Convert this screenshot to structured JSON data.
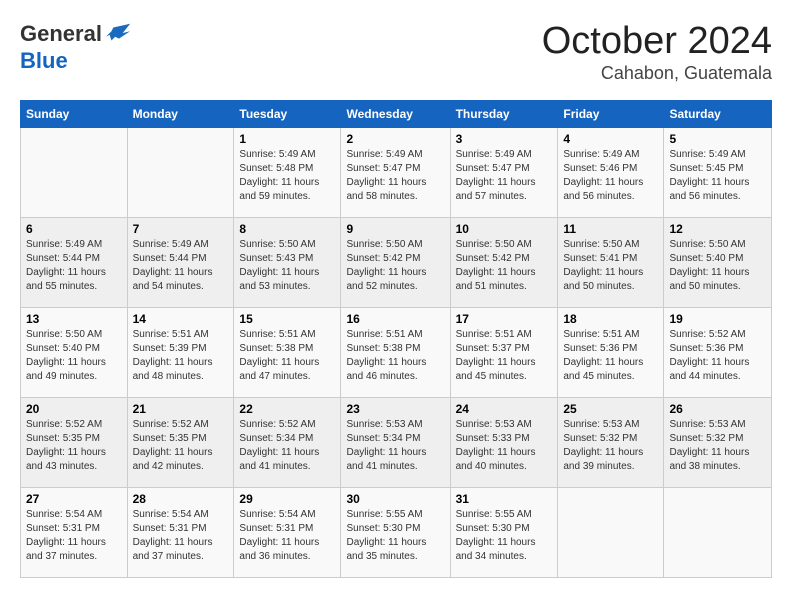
{
  "header": {
    "logo_general": "General",
    "logo_blue": "Blue",
    "month": "October 2024",
    "location": "Cahabon, Guatemala"
  },
  "weekdays": [
    "Sunday",
    "Monday",
    "Tuesday",
    "Wednesday",
    "Thursday",
    "Friday",
    "Saturday"
  ],
  "weeks": [
    [
      {
        "day": "",
        "info": ""
      },
      {
        "day": "",
        "info": ""
      },
      {
        "day": "1",
        "info": "Sunrise: 5:49 AM\nSunset: 5:48 PM\nDaylight: 11 hours and 59 minutes."
      },
      {
        "day": "2",
        "info": "Sunrise: 5:49 AM\nSunset: 5:47 PM\nDaylight: 11 hours and 58 minutes."
      },
      {
        "day": "3",
        "info": "Sunrise: 5:49 AM\nSunset: 5:47 PM\nDaylight: 11 hours and 57 minutes."
      },
      {
        "day": "4",
        "info": "Sunrise: 5:49 AM\nSunset: 5:46 PM\nDaylight: 11 hours and 56 minutes."
      },
      {
        "day": "5",
        "info": "Sunrise: 5:49 AM\nSunset: 5:45 PM\nDaylight: 11 hours and 56 minutes."
      }
    ],
    [
      {
        "day": "6",
        "info": "Sunrise: 5:49 AM\nSunset: 5:44 PM\nDaylight: 11 hours and 55 minutes."
      },
      {
        "day": "7",
        "info": "Sunrise: 5:49 AM\nSunset: 5:44 PM\nDaylight: 11 hours and 54 minutes."
      },
      {
        "day": "8",
        "info": "Sunrise: 5:50 AM\nSunset: 5:43 PM\nDaylight: 11 hours and 53 minutes."
      },
      {
        "day": "9",
        "info": "Sunrise: 5:50 AM\nSunset: 5:42 PM\nDaylight: 11 hours and 52 minutes."
      },
      {
        "day": "10",
        "info": "Sunrise: 5:50 AM\nSunset: 5:42 PM\nDaylight: 11 hours and 51 minutes."
      },
      {
        "day": "11",
        "info": "Sunrise: 5:50 AM\nSunset: 5:41 PM\nDaylight: 11 hours and 50 minutes."
      },
      {
        "day": "12",
        "info": "Sunrise: 5:50 AM\nSunset: 5:40 PM\nDaylight: 11 hours and 50 minutes."
      }
    ],
    [
      {
        "day": "13",
        "info": "Sunrise: 5:50 AM\nSunset: 5:40 PM\nDaylight: 11 hours and 49 minutes."
      },
      {
        "day": "14",
        "info": "Sunrise: 5:51 AM\nSunset: 5:39 PM\nDaylight: 11 hours and 48 minutes."
      },
      {
        "day": "15",
        "info": "Sunrise: 5:51 AM\nSunset: 5:38 PM\nDaylight: 11 hours and 47 minutes."
      },
      {
        "day": "16",
        "info": "Sunrise: 5:51 AM\nSunset: 5:38 PM\nDaylight: 11 hours and 46 minutes."
      },
      {
        "day": "17",
        "info": "Sunrise: 5:51 AM\nSunset: 5:37 PM\nDaylight: 11 hours and 45 minutes."
      },
      {
        "day": "18",
        "info": "Sunrise: 5:51 AM\nSunset: 5:36 PM\nDaylight: 11 hours and 45 minutes."
      },
      {
        "day": "19",
        "info": "Sunrise: 5:52 AM\nSunset: 5:36 PM\nDaylight: 11 hours and 44 minutes."
      }
    ],
    [
      {
        "day": "20",
        "info": "Sunrise: 5:52 AM\nSunset: 5:35 PM\nDaylight: 11 hours and 43 minutes."
      },
      {
        "day": "21",
        "info": "Sunrise: 5:52 AM\nSunset: 5:35 PM\nDaylight: 11 hours and 42 minutes."
      },
      {
        "day": "22",
        "info": "Sunrise: 5:52 AM\nSunset: 5:34 PM\nDaylight: 11 hours and 41 minutes."
      },
      {
        "day": "23",
        "info": "Sunrise: 5:53 AM\nSunset: 5:34 PM\nDaylight: 11 hours and 41 minutes."
      },
      {
        "day": "24",
        "info": "Sunrise: 5:53 AM\nSunset: 5:33 PM\nDaylight: 11 hours and 40 minutes."
      },
      {
        "day": "25",
        "info": "Sunrise: 5:53 AM\nSunset: 5:32 PM\nDaylight: 11 hours and 39 minutes."
      },
      {
        "day": "26",
        "info": "Sunrise: 5:53 AM\nSunset: 5:32 PM\nDaylight: 11 hours and 38 minutes."
      }
    ],
    [
      {
        "day": "27",
        "info": "Sunrise: 5:54 AM\nSunset: 5:31 PM\nDaylight: 11 hours and 37 minutes."
      },
      {
        "day": "28",
        "info": "Sunrise: 5:54 AM\nSunset: 5:31 PM\nDaylight: 11 hours and 37 minutes."
      },
      {
        "day": "29",
        "info": "Sunrise: 5:54 AM\nSunset: 5:31 PM\nDaylight: 11 hours and 36 minutes."
      },
      {
        "day": "30",
        "info": "Sunrise: 5:55 AM\nSunset: 5:30 PM\nDaylight: 11 hours and 35 minutes."
      },
      {
        "day": "31",
        "info": "Sunrise: 5:55 AM\nSunset: 5:30 PM\nDaylight: 11 hours and 34 minutes."
      },
      {
        "day": "",
        "info": ""
      },
      {
        "day": "",
        "info": ""
      }
    ]
  ]
}
